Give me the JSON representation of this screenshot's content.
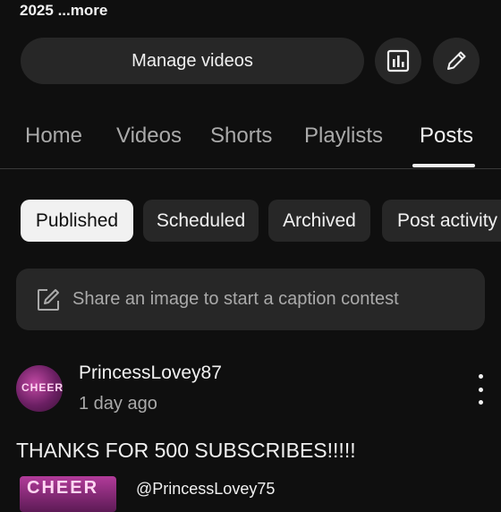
{
  "description_tail": {
    "year": "2025",
    "more": "...more"
  },
  "actions": {
    "manage_videos": "Manage videos",
    "analytics_icon": "bar-chart-icon",
    "edit_icon": "pencil-icon"
  },
  "tabs": [
    {
      "label": "Home",
      "active": false
    },
    {
      "label": "Videos",
      "active": false
    },
    {
      "label": "Shorts",
      "active": false
    },
    {
      "label": "Playlists",
      "active": false
    },
    {
      "label": "Posts",
      "active": true
    }
  ],
  "filters": [
    {
      "label": "Published",
      "selected": true
    },
    {
      "label": "Scheduled",
      "selected": false
    },
    {
      "label": "Archived",
      "selected": false
    },
    {
      "label": "Post activity",
      "selected": false
    }
  ],
  "caption_contest": {
    "text": "Share an image to start a caption contest",
    "icon": "edit-square-icon"
  },
  "post": {
    "author": "PrincessLovey87",
    "time": "1 day ago",
    "avatar_text": "CHEER",
    "text": "THANKS FOR 500 SUBSCRIBES!!!!!",
    "attachment_text": "CHEER",
    "attachment_user": "@PrincessLovey75"
  },
  "colors": {
    "background": "#0f0f0f",
    "surface": "#272727",
    "text": "#f1f1f1",
    "muted": "#aaaaaa"
  }
}
